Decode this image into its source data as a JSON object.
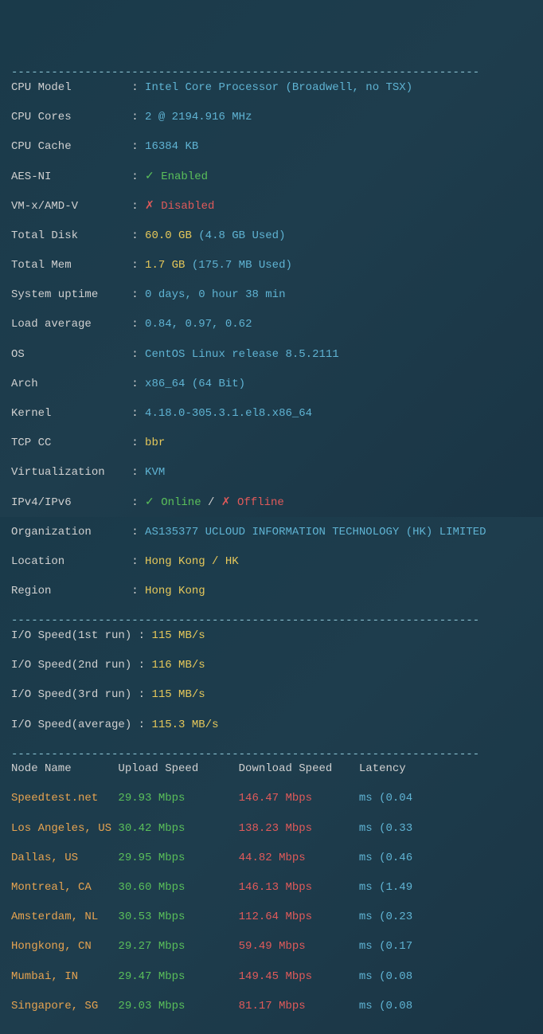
{
  "dash_line": "----------------------------------------------------------------------",
  "sys": {
    "cpu_model": {
      "label": "CPU Model        ",
      "sep": " : ",
      "value": "Intel Core Processor (Broadwell, no TSX)"
    },
    "cpu_cores": {
      "label": "CPU Cores        ",
      "sep": " : ",
      "value": "2 @ 2194.916 MHz"
    },
    "cpu_cache": {
      "label": "CPU Cache        ",
      "sep": " : ",
      "value": "16384 KB"
    },
    "aes": {
      "label": "AES-NI           ",
      "sep": " : ",
      "tick": "✓ ",
      "value": "Enabled"
    },
    "vmx": {
      "label": "VM-x/AMD-V       ",
      "sep": " : ",
      "tick": "✗ ",
      "value": "Disabled"
    },
    "disk": {
      "label": "Total Disk       ",
      "sep": " : ",
      "value": "60.0 GB",
      "sub": " (4.8 GB Used)"
    },
    "mem": {
      "label": "Total Mem        ",
      "sep": " : ",
      "value": "1.7 GB",
      "sub": " (175.7 MB Used)"
    },
    "uptime": {
      "label": "System uptime    ",
      "sep": " : ",
      "value": "0 days, 0 hour 38 min"
    },
    "load": {
      "label": "Load average     ",
      "sep": " : ",
      "value": "0.84, 0.97, 0.62"
    },
    "os": {
      "label": "OS               ",
      "sep": " : ",
      "value": "CentOS Linux release 8.5.2111"
    },
    "arch": {
      "label": "Arch             ",
      "sep": " : ",
      "value": "x86_64 (64 Bit)"
    },
    "kernel": {
      "label": "Kernel           ",
      "sep": " : ",
      "value": "4.18.0-305.3.1.el8.x86_64"
    },
    "tcpcc": {
      "label": "TCP CC           ",
      "sep": " : ",
      "value": "bbr"
    },
    "virt": {
      "label": "Virtualization   ",
      "sep": " : ",
      "value": "KVM"
    },
    "ipv": {
      "label": "IPv4/IPv6        ",
      "sep": " : ",
      "online_tick": "✓ ",
      "online": "Online",
      "slash": " / ",
      "offline_tick": "✗ ",
      "offline": "Offline"
    },
    "org": {
      "label": "Organization     ",
      "sep": " : ",
      "value": "AS135377 UCLOUD INFORMATION TECHNOLOGY (HK) LIMITED"
    },
    "loc": {
      "label": "Location         ",
      "sep": " : ",
      "value": "Hong Kong / HK"
    },
    "reg": {
      "label": "Region           ",
      "sep": " : ",
      "value": "Hong Kong"
    }
  },
  "io": {
    "r1": {
      "label": "I/O Speed(1st run)",
      "sep": " : ",
      "value": "115 MB/s"
    },
    "r2": {
      "label": "I/O Speed(2nd run)",
      "sep": " : ",
      "value": "116 MB/s"
    },
    "r3": {
      "label": "I/O Speed(3rd run)",
      "sep": " : ",
      "value": "115 MB/s"
    },
    "avg": {
      "label": "I/O Speed(average)",
      "sep": " : ",
      "value": "115.3 MB/s"
    }
  },
  "hdr": {
    "node": "Node Name       ",
    "up": "Upload Speed      ",
    "down": "Download Speed    ",
    "lat": "Latency    "
  },
  "nodes": [
    {
      "name": "Speedtest.net   ",
      "up": "29.93 Mbps        ",
      "down": "146.47 Mbps       ",
      "lat": "ms (0.04"
    },
    {
      "name": "Los Angeles, US ",
      "up": "30.42 Mbps        ",
      "down": "138.23 Mbps       ",
      "lat": "ms (0.33"
    },
    {
      "name": "Dallas, US      ",
      "up": "29.95 Mbps        ",
      "down": "44.82 Mbps        ",
      "lat": "ms (0.46"
    },
    {
      "name": "Montreal, CA    ",
      "up": "30.60 Mbps        ",
      "down": "146.13 Mbps       ",
      "lat": "ms (1.49"
    },
    {
      "name": "Amsterdam, NL   ",
      "up": "30.53 Mbps        ",
      "down": "112.64 Mbps       ",
      "lat": "ms (0.23"
    },
    {
      "name": "Hongkong, CN    ",
      "up": "29.27 Mbps        ",
      "down": "59.49 Mbps        ",
      "lat": "ms (0.17"
    },
    {
      "name": "Mumbai, IN      ",
      "up": "29.47 Mbps        ",
      "down": "149.45 Mbps       ",
      "lat": "ms (0.08"
    },
    {
      "name": "Singapore, SG   ",
      "up": "29.03 Mbps        ",
      "down": "81.17 Mbps        ",
      "lat": "ms (0.08"
    }
  ]
}
